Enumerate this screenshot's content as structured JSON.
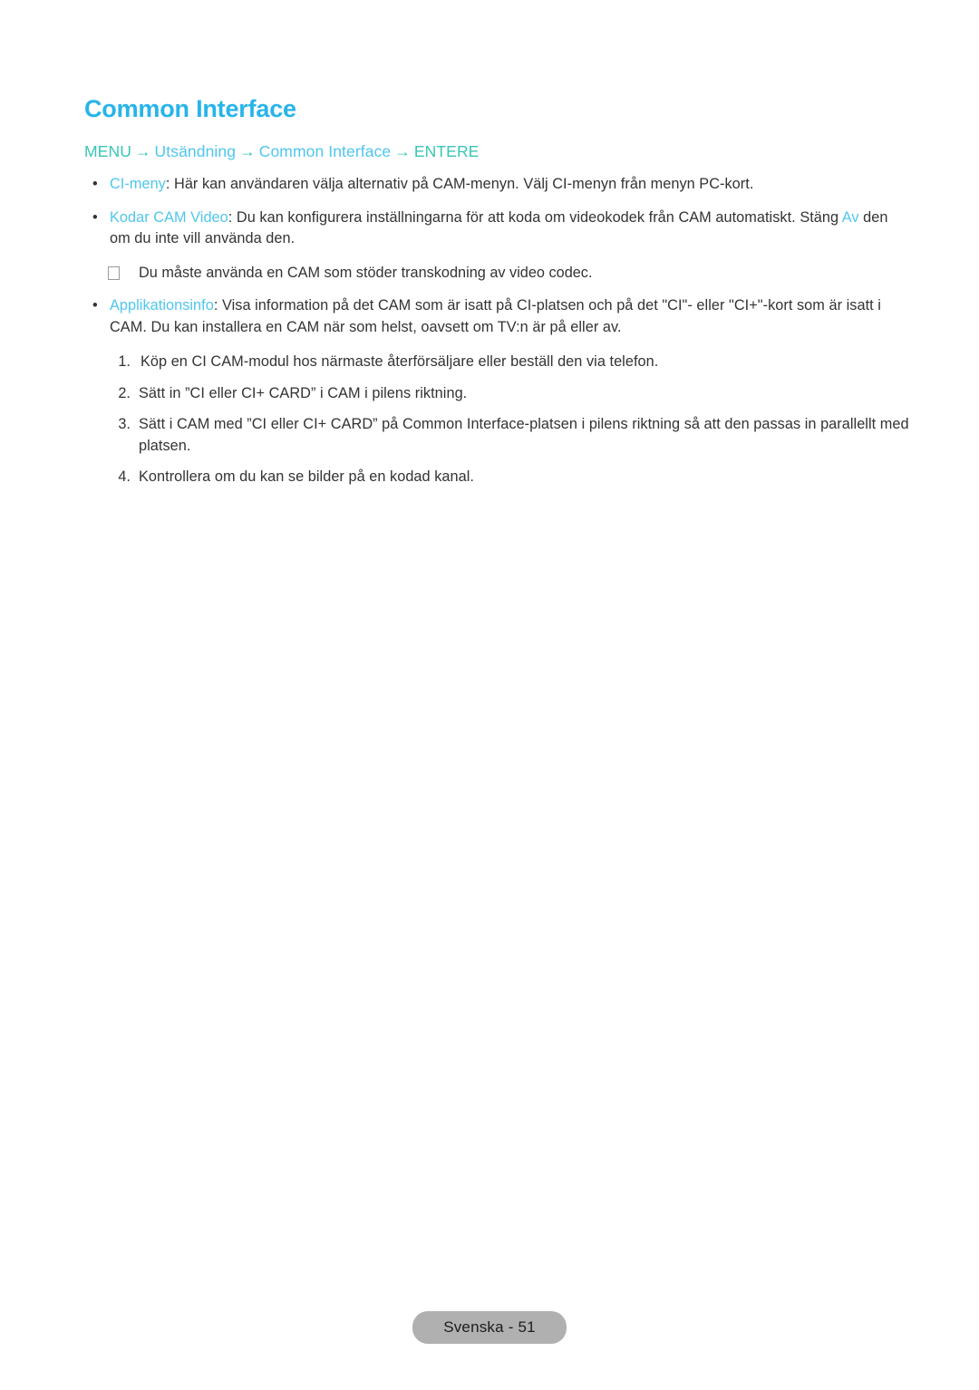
{
  "document": {
    "title": "Common Interface",
    "language": "Svenska"
  },
  "breadcrumb": {
    "items": [
      {
        "label": "MENU",
        "style": "key"
      },
      {
        "label": "Utsändning",
        "style": "menu"
      },
      {
        "label": "Common Interface",
        "style": "menu"
      },
      {
        "label": "ENTERE",
        "style": "key"
      }
    ],
    "separator": "→"
  },
  "bullets": [
    {
      "marker": "•",
      "term": "CI-meny",
      "text": ": Här kan användaren välja alternativ på CAM-menyn. Välj CI-menyn från menyn PC-kort."
    },
    {
      "marker": "•",
      "term": "Kodar CAM Video",
      "text": ": Du kan konfigurera inställningarna för att koda om videokodek från CAM automatiskt. Stäng ",
      "trailing_term": "Av",
      "text_after": " den om du inte vill använda den."
    },
    {
      "marker": "•",
      "term": "Applikationsinfo",
      "text": ": Visa information på det CAM som är isatt på CI-platsen och på det \"CI\"- eller \"CI+\"-kort som är isatt i CAM. Du kan installera en CAM när som helst, oavsett om TV:n är på eller av."
    }
  ],
  "note": {
    "glyph": "note-box-glyph",
    "text": "Du måste använda en CAM som stöder transkodning av video codec."
  },
  "steps": [
    {
      "number": "1.",
      "text": "Köp en CI CAM-modul hos närmaste återförsäljare eller beställ den via telefon."
    },
    {
      "number": "2.",
      "text": "Sätt in ”CI eller CI+ CARD” i CAM i pilens riktning."
    },
    {
      "number": "3.",
      "text": "Sätt i CAM med ”CI eller CI+ CARD” på Common Interface-platsen i pilens riktning så att den passas in parallellt med platsen."
    },
    {
      "number": "4.",
      "text": "Kontrollera om du kan se bilder på en kodad kanal."
    }
  ],
  "footer": {
    "page_label": "Svenska - 51"
  },
  "colors": {
    "title": "#27b4ea",
    "menu_term": "#4fc6ee",
    "key_term": "#39c6b4",
    "body_text": "#333333",
    "badge_bg": "#b0b0b0"
  }
}
